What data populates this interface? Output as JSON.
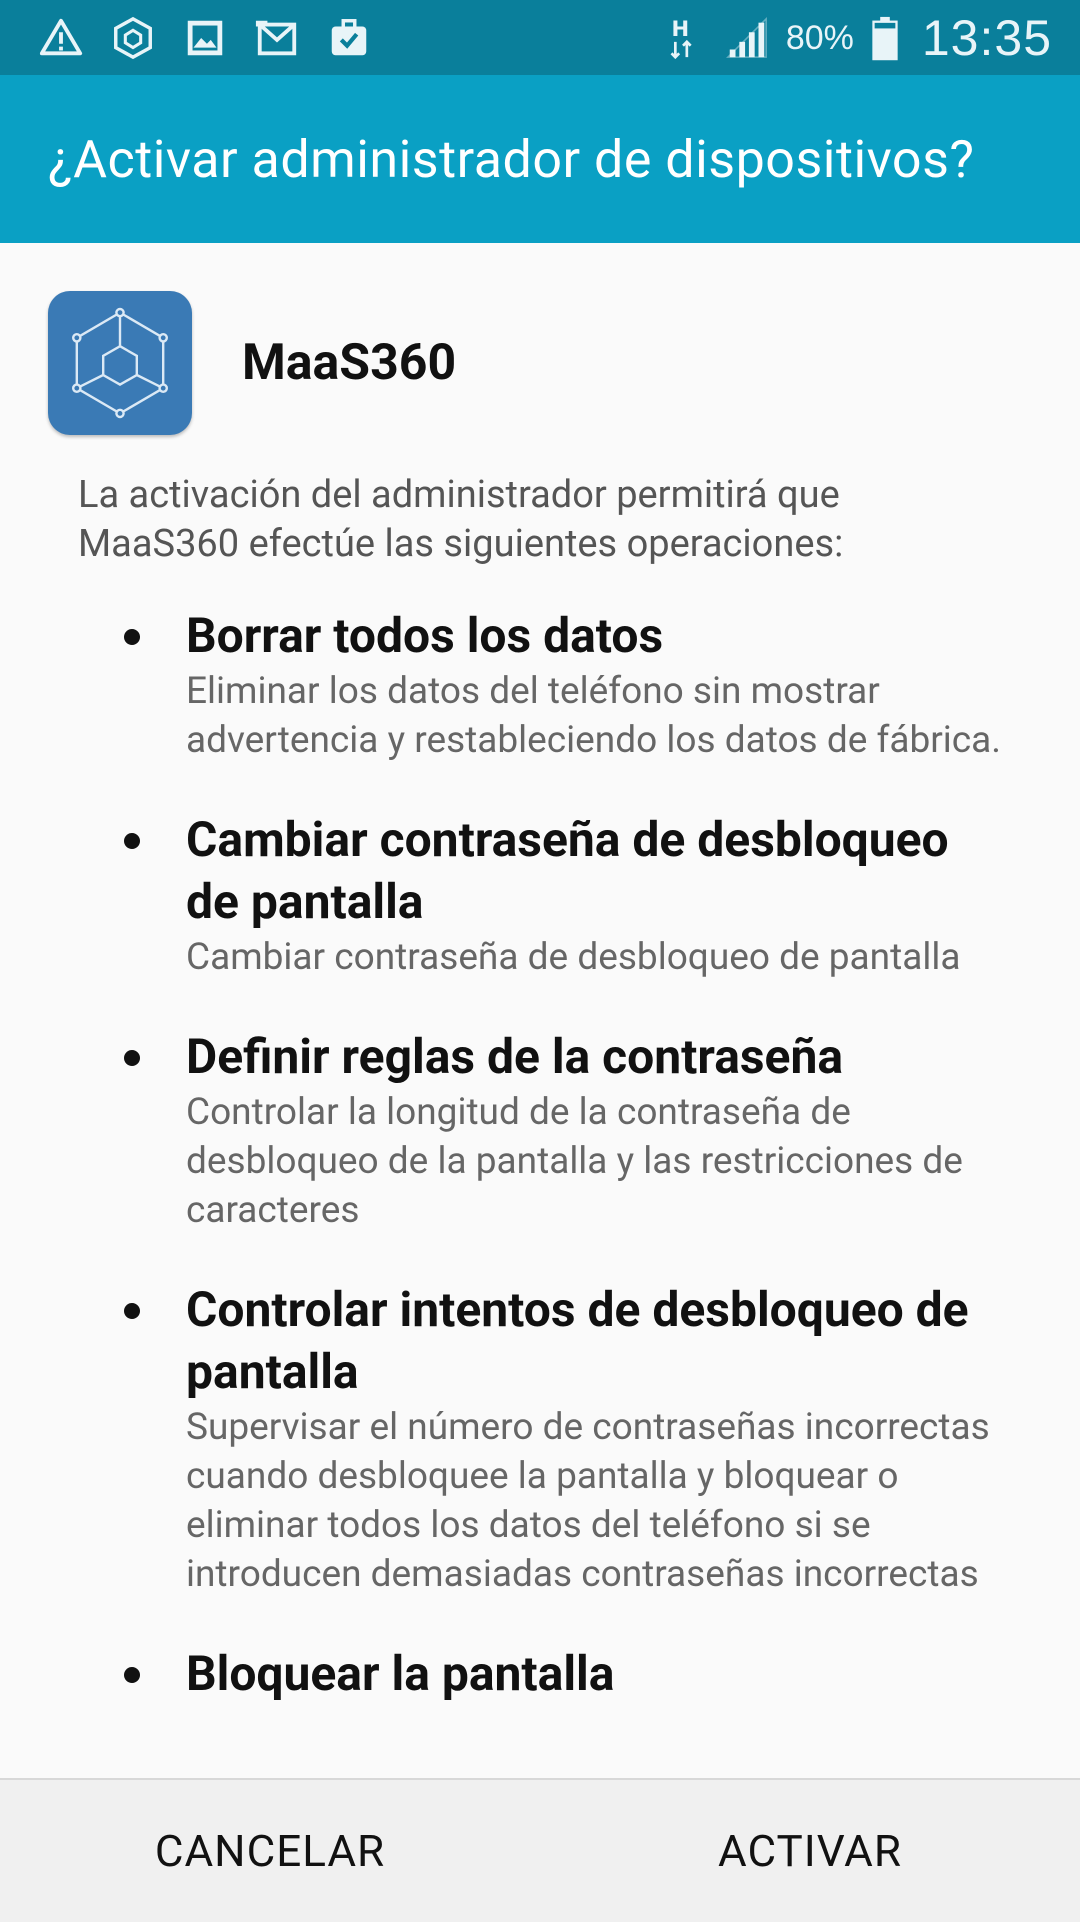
{
  "status_bar": {
    "icons": [
      "warning-icon",
      "maas360-notification-icon",
      "gallery-icon",
      "email-icon",
      "briefcase-check-icon"
    ],
    "network": "H",
    "battery_percent": "80%",
    "time": "13:35"
  },
  "title_bar": {
    "title": "¿Activar administrador de dispositivos?"
  },
  "app": {
    "name": "MaaS360",
    "icon": "maas360-cube-icon"
  },
  "intro_text": "La activación del administrador permitirá que MaaS360 efectúe las siguientes operaciones:",
  "permissions": [
    {
      "title": "Borrar todos los datos",
      "description": "Eliminar los datos del teléfono sin mostrar advertencia y restableciendo los datos de fábrica."
    },
    {
      "title": "Cambiar contraseña de desbloqueo de pantalla",
      "description": "Cambiar contraseña de desbloqueo de pantalla"
    },
    {
      "title": "Definir reglas de la contraseña",
      "description": "Controlar la longitud de la contraseña de desbloqueo de la pantalla y las restricciones de caracteres"
    },
    {
      "title": "Controlar intentos de desbloqueo de pantalla",
      "description": "Supervisar el número de contraseñas incorrectas cuando desbloquee la pantalla y bloquear o eliminar todos los datos del teléfono si se introducen demasiadas contraseñas incorrectas"
    },
    {
      "title": "Bloquear la pantalla",
      "description": ""
    }
  ],
  "buttons": {
    "cancel": "CANCELAR",
    "activate": "ACTIVAR"
  },
  "colors": {
    "status_bar": "#0a7f9b",
    "title_bar": "#0aa0c4",
    "app_icon": "#3a7ab5"
  }
}
